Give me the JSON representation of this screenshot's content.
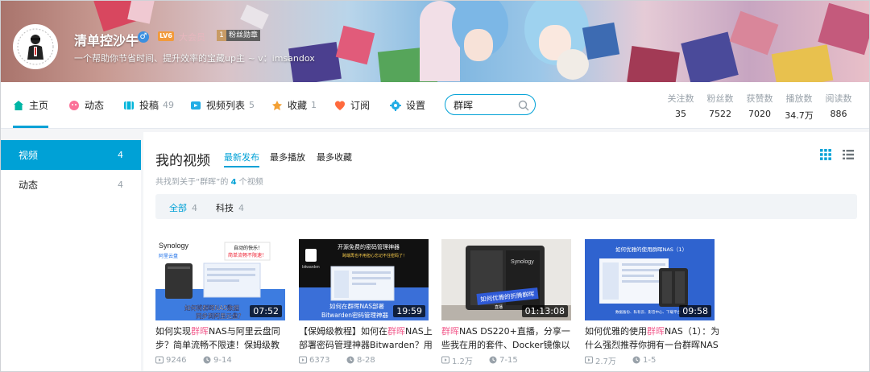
{
  "profile": {
    "name": "清单控沙牛",
    "level": "LV6",
    "vip": "大会员",
    "fan_badge_level": "1",
    "fan_badge": "粉丝勋章",
    "sign": "一个帮助你节省时间、提升效率的宝藏up主 ~ v：imsandox"
  },
  "nav": {
    "items": [
      {
        "label": "主页",
        "count": ""
      },
      {
        "label": "动态",
        "count": ""
      },
      {
        "label": "投稿",
        "count": "49"
      },
      {
        "label": "视频列表",
        "count": "5"
      },
      {
        "label": "收藏",
        "count": "1"
      },
      {
        "label": "订阅",
        "count": ""
      },
      {
        "label": "设置",
        "count": ""
      }
    ],
    "search_value": "群晖",
    "stats": [
      {
        "label": "关注数",
        "value": "35"
      },
      {
        "label": "粉丝数",
        "value": "7522"
      },
      {
        "label": "获赞数",
        "value": "7020"
      },
      {
        "label": "播放数",
        "value": "34.7万"
      },
      {
        "label": "阅读数",
        "value": "886"
      }
    ]
  },
  "sidebar": {
    "items": [
      {
        "label": "视频",
        "count": "4"
      },
      {
        "label": "动态",
        "count": "4"
      }
    ]
  },
  "main": {
    "title": "我的视频",
    "sorts": [
      "最新发布",
      "最多播放",
      "最多收藏"
    ],
    "found_prefix": "共找到关于“群晖”的",
    "found_count": "4",
    "found_suffix": "个视频",
    "filters": [
      {
        "label": "全部",
        "count": "4"
      },
      {
        "label": "科技",
        "count": "4"
      }
    ]
  },
  "videos": [
    {
      "duration": "07:52",
      "title_pre": "如何实现",
      "title_hl": "群晖",
      "title_post": "NAS与阿里云盘同步？简单流畅不限速！保姆级教",
      "plays": "9246",
      "date": "9-14",
      "thumb_text": [
        "Synology",
        "阿里云盘",
        "自动的快乐！",
        "简单流畅不限速！",
        "如何将群晖NAS数据",
        "同步到阿里云盘？"
      ]
    },
    {
      "duration": "19:59",
      "title_pre": "【保姆级教程】如何在",
      "title_hl": "群晖",
      "title_post": "NAS上部署密码管理神器Bitwarden？用免",
      "plays": "6373",
      "date": "8-28",
      "thumb_text": [
        "开源免费的密码管理神器",
        "跨端再也不用担心忘记不住密码了！",
        "bitwarden",
        "如何在群晖NAS部署",
        "Bitwarden密码管理神器"
      ]
    },
    {
      "duration": "01:13:08",
      "title_pre": "",
      "title_hl": "群晖",
      "title_post": "NAS DS220+直播，分享一些我在用的套件、Docker镜像以及一",
      "plays": "1.2万",
      "date": "7-15",
      "thumb_text": [
        "Synology",
        "如何优雅的折腾群晖",
        "直播"
      ]
    },
    {
      "duration": "09:58",
      "title_pre": "如何优雅的使用",
      "title_hl": "群晖",
      "title_post": "NAS（1）：为什么强烈推荐你拥有一台群晖NAS",
      "plays": "2.7万",
      "date": "1-5",
      "thumb_text": [
        "如何优雅的使用群晖NAS（1）",
        "数据备份、私有云、影音中心、下载平台"
      ]
    }
  ],
  "colors": {
    "accent": "#00a1d6",
    "highlight": "#f25d8e",
    "muted": "#99a2aa"
  },
  "icons": [
    "home-icon",
    "dynamic-icon",
    "upload-icon",
    "video-list-icon",
    "favorite-icon",
    "subscribe-icon",
    "settings-icon",
    "search-icon",
    "grid-view-icon",
    "list-view-icon",
    "play-icon",
    "clock-icon"
  ]
}
